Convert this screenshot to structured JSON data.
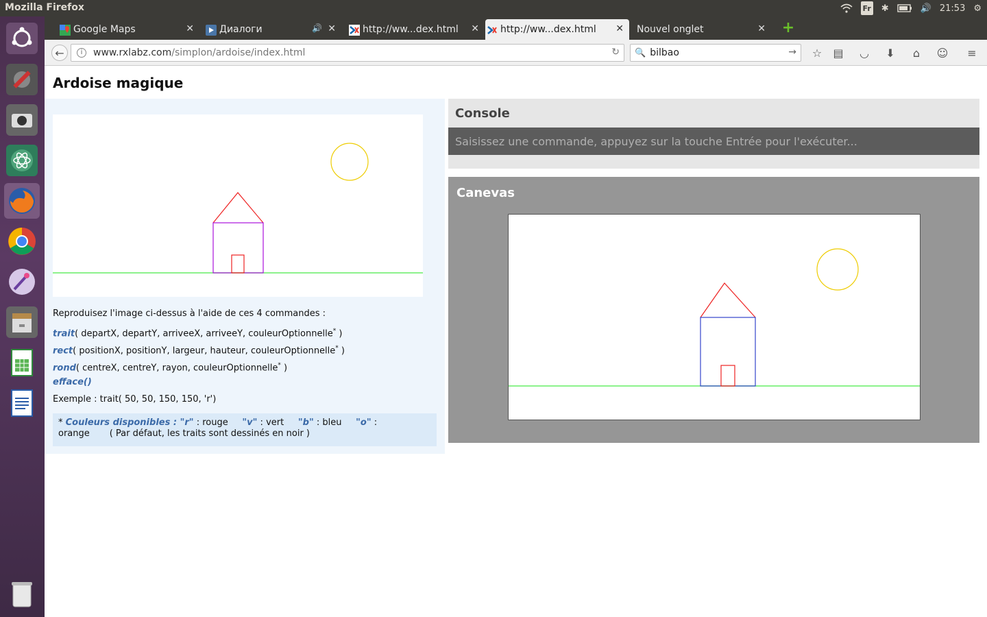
{
  "system": {
    "app_title": "Mozilla Firefox",
    "keyboard_layout": "Fr",
    "clock": "21:53"
  },
  "tabs": [
    {
      "label": "Google Maps",
      "icon": "google-maps-icon"
    },
    {
      "label": "Диалоги",
      "icon": "vk-icon"
    },
    {
      "label": "http://ww...dex.html",
      "icon": "rxlabz-icon"
    },
    {
      "label": "http://ww...dex.html",
      "icon": "rxlabz-icon",
      "active": true
    },
    {
      "label": "Nouvel onglet",
      "icon": ""
    }
  ],
  "navbar": {
    "url_host": "www.rxlabz.com",
    "url_path": "/simplon/ardoise/index.html",
    "search_value": "bilbao"
  },
  "page": {
    "title": "Ardoise magique",
    "instructions": {
      "intro": "Reproduisez l'image ci-dessus à l'aide de ces 4 commandes :",
      "cmd1_name": "trait",
      "cmd1_args": "( departX, departY, arriveeX, arriveeY, couleurOptionnelle",
      "cmd2_name": "rect",
      "cmd2_args": "( positionX, positionY, largeur, hauteur, couleurOptionnelle",
      "cmd3_name": "rond",
      "cmd3_args": "( centreX, centreY, rayon, couleurOptionnelle",
      "cmd4_name": "efface()",
      "example": "Exemple : trait( 50, 50, 150, 150, 'r')",
      "star": "*",
      "close_paren": " )"
    },
    "colors_box": {
      "star": "* ",
      "heading": "Couleurs disponibles : ",
      "r_key": "\"r\"",
      "r_label": " : rouge",
      "v_key": "\"v\"",
      "v_label": " : vert",
      "b_key": "\"b\"",
      "b_label": " : bleu",
      "o_key": "\"o\"",
      "o_label": " : orange",
      "default_note": "( Par défaut, les traits sont dessinés en noir )"
    },
    "console": {
      "title": "Console",
      "placeholder": "Saisissez une commande, appuyez sur la touche Entrée pour l'exécuter..."
    },
    "canvas": {
      "title": "Canevas"
    }
  },
  "colors": {
    "ground": "#66ee66",
    "roof": "#ee2222",
    "house_model": "#aa11dd",
    "house_canvas": "#3344cc",
    "door": "#ee2222",
    "sun": "#eecc00",
    "accent": "#3b6aa8"
  }
}
